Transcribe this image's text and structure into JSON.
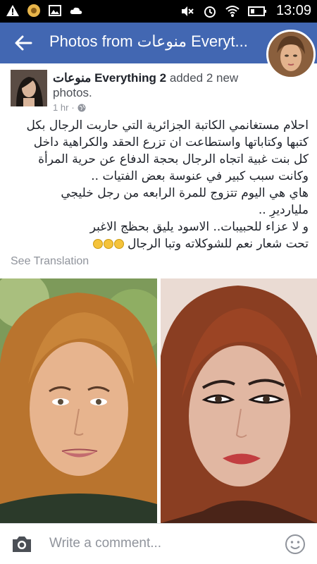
{
  "status_bar": {
    "time": "13:09",
    "left_icons": [
      "warning-icon",
      "notification-icon",
      "image-icon",
      "cloud-icon"
    ],
    "right_icons": [
      "mute-icon",
      "alarm-icon",
      "wifi-icon",
      "battery-icon"
    ]
  },
  "app_bar": {
    "title": "Photos from منوعات Everyt...",
    "back_icon": "back-arrow-icon",
    "color": "#4267b2"
  },
  "post": {
    "poster_name": "منوعات Everything 2",
    "action": " added 2 new photos.",
    "time": "1 hr",
    "privacy_icon": "globe-icon",
    "lines": [
      "احلام مستغانمي الكاتبة الجزائرية التي حاربت الرجال بكل",
      "كتبها وكتاباتها واستطاعت ان تزرع الحقد والكراهية داخل",
      "كل بنت غبية اتجاه الرجال بحجة الدفاع عن حرية المرأة",
      "وكانت سبب كبير في عنوسة بعض الفتيات ..",
      "هاي هي اليوم تتزوج للمرة الرابعه من رجل خليجي",
      "مليارديرِ ..",
      "و لا عزاء للحبيبات.. الاسود يليق بحظج الاغبر",
      "تحت شعار نعم للشوكلاته وتبا الرجال"
    ],
    "emoji_count": 3,
    "see_translation": "See Translation"
  },
  "photos": [
    {
      "name": "photo-left"
    },
    {
      "name": "photo-right"
    }
  ],
  "comment_bar": {
    "placeholder": "Write a comment...",
    "camera_icon": "camera-icon",
    "emoji_icon": "smiley-icon"
  }
}
